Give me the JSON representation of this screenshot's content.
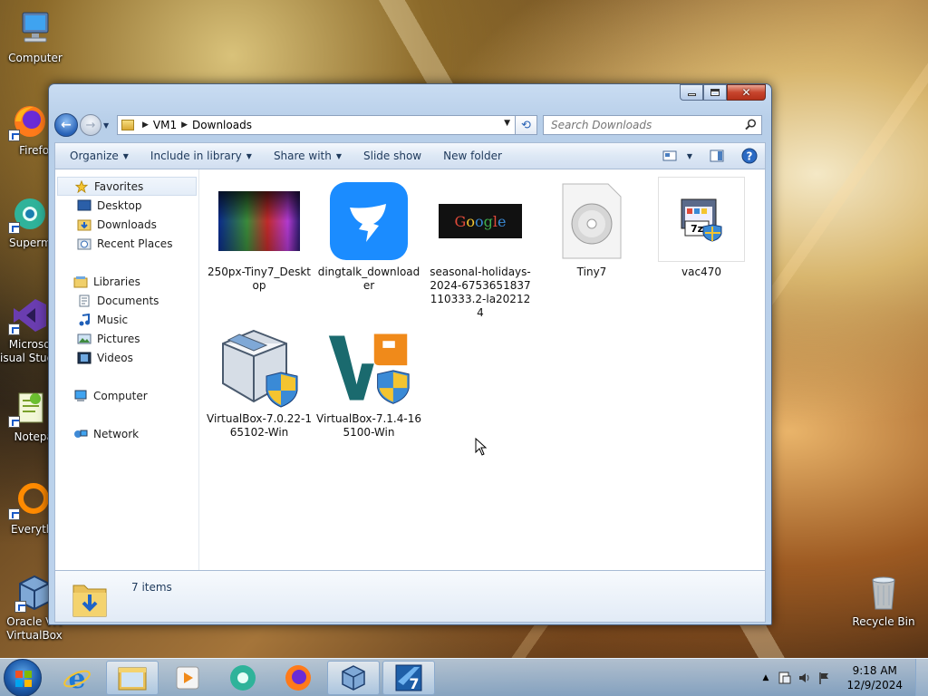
{
  "desktop": {
    "icons": [
      {
        "label": "Computer",
        "icon": "computer-icon"
      },
      {
        "label": "Firefox",
        "icon": "firefox-icon"
      },
      {
        "label": "Supermium",
        "icon": "supermium-icon"
      },
      {
        "label": "Microsoft Visual Studio",
        "icon": "visual-studio-icon"
      },
      {
        "label": "Notepad",
        "icon": "notepad-icon"
      },
      {
        "label": "Everything",
        "icon": "everything-icon"
      },
      {
        "label": "Oracle VM VirtualBox",
        "icon": "virtualbox-icon"
      },
      {
        "label": "Recycle Bin",
        "icon": "recycle-bin-icon"
      }
    ]
  },
  "explorer": {
    "address": {
      "root": "VM1",
      "current": "Downloads"
    },
    "search": {
      "placeholder": "Search Downloads"
    },
    "toolbar": {
      "organize": "Organize",
      "include_in_library": "Include in library",
      "share_with": "Share with",
      "slide_show": "Slide show",
      "new_folder": "New folder"
    },
    "navpane": {
      "favorites": "Favorites",
      "desktop": "Desktop",
      "downloads": "Downloads",
      "recent_places": "Recent Places",
      "libraries": "Libraries",
      "documents": "Documents",
      "music": "Music",
      "pictures": "Pictures",
      "videos": "Videos",
      "computer": "Computer",
      "network": "Network"
    },
    "files": [
      {
        "name": "250px-Tiny7_Desktop",
        "icon": "image-thumbnail-icon"
      },
      {
        "name": "dingtalk_downloader",
        "icon": "dingtalk-icon"
      },
      {
        "name": "seasonal-holidays-2024-6753651837110333.2-la202124",
        "icon": "google-doodle-thumbnail-icon"
      },
      {
        "name": "Tiny7",
        "icon": "disc-image-icon"
      },
      {
        "name": "vac470",
        "icon": "7z-installer-icon"
      },
      {
        "name": "VirtualBox-7.0.22-165102-Win",
        "icon": "virtualbox-installer-icon"
      },
      {
        "name": "VirtualBox-7.1.4-165100-Win",
        "icon": "virtualbox-installer-icon"
      }
    ],
    "status": {
      "count": "7 items"
    }
  },
  "taskbar": {
    "apps": [
      "internet-explorer-icon",
      "explorer-icon",
      "media-player-icon",
      "supermium-icon",
      "firefox-icon",
      "virtualbox-icon",
      "tiny7-icon"
    ],
    "clock": {
      "time": "9:18 AM",
      "date": "12/9/2024"
    }
  },
  "colors": {
    "window_frame": "#bcd3ec",
    "toolbar_text": "#1e395b",
    "close_button": "#c7452d",
    "start_orb": "#1d5bab"
  }
}
